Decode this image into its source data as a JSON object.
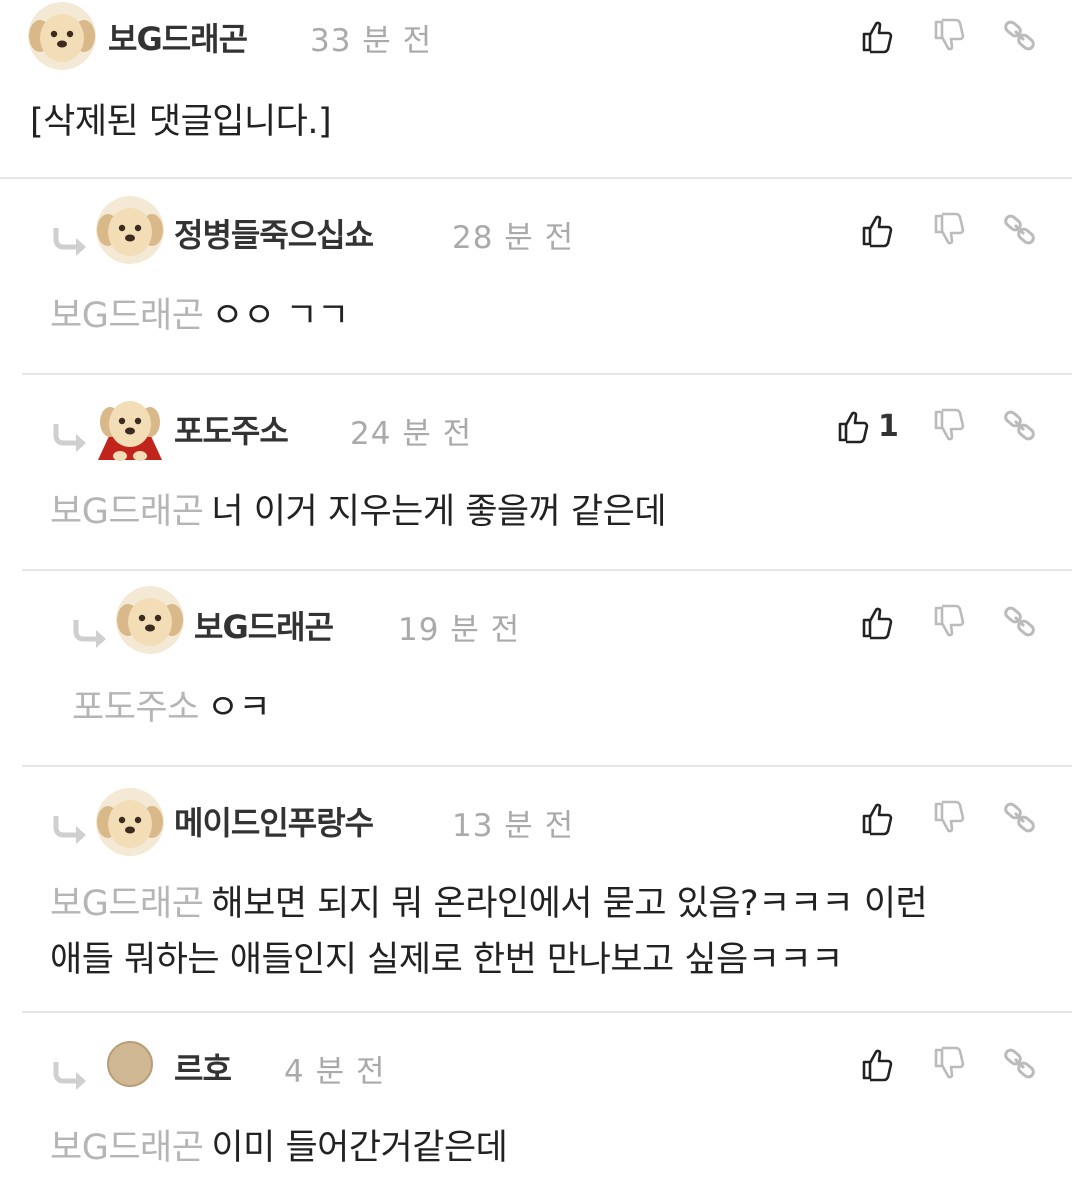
{
  "comments": [
    {
      "nickname": "보G드래곤",
      "time": "33 분 전",
      "mention": "",
      "text": "[삭제된 댓글입니다.]",
      "likes": "",
      "avatar": "puppy-icon"
    },
    {
      "nickname": "정병들죽으십쇼",
      "time": "28 분 전",
      "mention": "보G드래곤",
      "text": "ㅇㅇ ㄱㄱ",
      "likes": "",
      "avatar": "puppy-icon"
    },
    {
      "nickname": "포도주소",
      "time": "24 분 전",
      "mention": "보G드래곤",
      "text": "너 이거 지우는게 좋을꺼 같은데",
      "likes": "1",
      "avatar": "puppy-cape-icon"
    },
    {
      "nickname": "보G드래곤",
      "time": "19 분 전",
      "mention": "포도주소",
      "text": "ㅇㅋ",
      "likes": "",
      "avatar": "puppy-icon"
    },
    {
      "nickname": "메이드인푸랑수",
      "time": "13 분 전",
      "mention": "보G드래곤",
      "text_line1": "해보면 되지 뭐 온라인에서 묻고 있음?ㅋㅋㅋ 이런",
      "text_line2": "애들 뭐하는 애들인지 실제로 한번 만나보고 싶음ㅋㅋㅋ",
      "likes": "",
      "avatar": "puppy-icon"
    },
    {
      "nickname": "르호",
      "time": "4 분 전",
      "mention": "보G드래곤",
      "text": "이미 들어간거같은데",
      "likes": "",
      "avatar": "plain-circle-icon"
    }
  ],
  "icons": {
    "like": "thumbs-up-icon",
    "dislike": "thumbs-down-icon",
    "link": "link-icon",
    "reply": "reply-arrow-icon"
  }
}
